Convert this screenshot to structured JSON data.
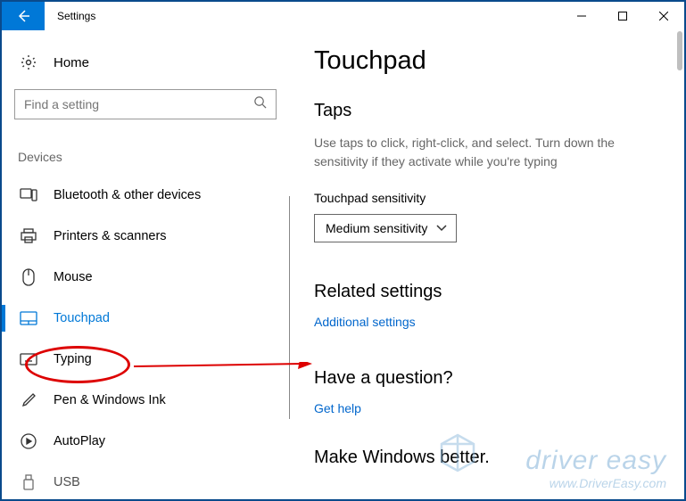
{
  "window": {
    "title": "Settings"
  },
  "sidebar": {
    "home_label": "Home",
    "search_placeholder": "Find a setting",
    "category_label": "Devices",
    "items": [
      {
        "label": "Bluetooth & other devices"
      },
      {
        "label": "Printers & scanners"
      },
      {
        "label": "Mouse"
      },
      {
        "label": "Touchpad"
      },
      {
        "label": "Typing"
      },
      {
        "label": "Pen & Windows Ink"
      },
      {
        "label": "AutoPlay"
      },
      {
        "label": "USB"
      }
    ]
  },
  "main": {
    "page_title": "Touchpad",
    "taps_heading": "Taps",
    "taps_desc": "Use taps to click, right-click, and select. Turn down the sensitivity if they activate while you're typing",
    "sensitivity_label": "Touchpad sensitivity",
    "sensitivity_value": "Medium sensitivity",
    "related_heading": "Related settings",
    "related_link": "Additional settings",
    "question_heading": "Have a question?",
    "question_link": "Get help",
    "better_heading": "Make Windows better."
  },
  "watermark": {
    "line1": "driver easy",
    "line2": "www.DriverEasy.com"
  }
}
